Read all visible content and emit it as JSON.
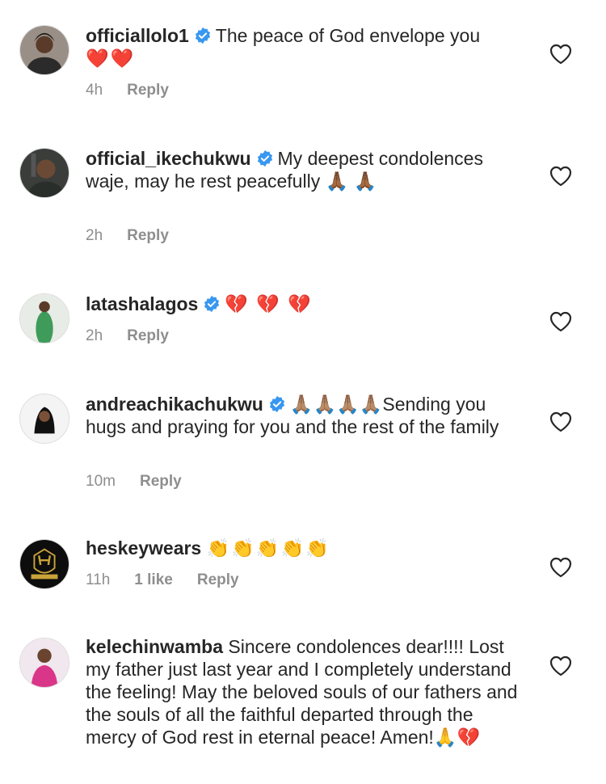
{
  "comments": [
    {
      "username": "officiallolo1",
      "verified": true,
      "text": "The peace of God envelope you",
      "emojis": "❤️❤️",
      "time": "4h",
      "likes": "",
      "reply_label": "Reply"
    },
    {
      "username": "official_ikechukwu",
      "verified": true,
      "text": "My deepest condolences waje, may he rest peacefully 🙏🏾 🙏🏾",
      "emojis": "",
      "time": "2h",
      "likes": "",
      "reply_label": "Reply"
    },
    {
      "username": "latashalagos",
      "verified": true,
      "text": "",
      "emojis": "💔 💔 💔",
      "time": "2h",
      "likes": "",
      "reply_label": "Reply"
    },
    {
      "username": "andreachikachukwu",
      "verified": true,
      "text": "🙏🏽🙏🏽🙏🏽🙏🏽Sending you hugs and praying for you and the rest of the family",
      "emojis": "",
      "time": "10m",
      "likes": "",
      "reply_label": "Reply"
    },
    {
      "username": "heskeywears",
      "verified": false,
      "text": "👏👏👏👏👏",
      "emojis": "",
      "time": "11h",
      "likes": "1 like",
      "reply_label": "Reply"
    },
    {
      "username": "kelechinwamba",
      "verified": false,
      "text": "Sincere condolences dear!!!! Lost my father just last year and I completely understand the feeling! May the beloved souls of our fathers and the souls of all the faithful departed through the mercy of God rest in eternal peace! Amen!🙏💔",
      "emojis": "",
      "time": "",
      "likes": "",
      "reply_label": ""
    }
  ],
  "icons": {
    "like": "heart-outline-icon",
    "verified": "verified-badge-icon"
  },
  "colors": {
    "text": "#262626",
    "meta": "#8e8e8e",
    "verified": "#3897f0"
  }
}
